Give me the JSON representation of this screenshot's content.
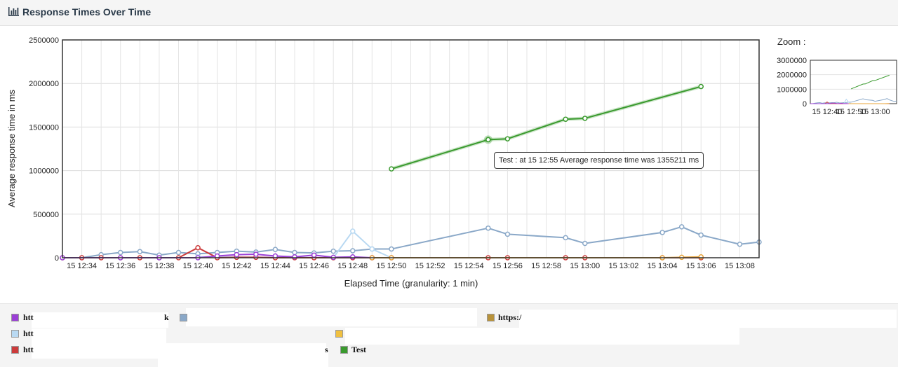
{
  "panel": {
    "title": "Response Times Over Time",
    "icon": "bar-chart-icon"
  },
  "chart_data": {
    "type": "line",
    "ylabel": "Average response time in ms",
    "xlabel": "Elapsed Time (granularity: 1 min)",
    "ylim": [
      0,
      2500000
    ],
    "yticks": [
      0,
      500000,
      1000000,
      1500000,
      2000000,
      2500000
    ],
    "xlim": [
      "12:33",
      "13:09"
    ],
    "xtick_labels": [
      "15 12:34",
      "15 12:36",
      "15 12:38",
      "15 12:40",
      "15 12:42",
      "15 12:44",
      "15 12:46",
      "15 12:48",
      "15 12:50",
      "15 12:52",
      "15 12:54",
      "15 12:56",
      "15 12:58",
      "15 13:00",
      "15 13:02",
      "15 13:04",
      "15 13:06",
      "15 13:08"
    ],
    "grid": true,
    "series": [
      {
        "name": "Test",
        "color": "#3a9a2e",
        "points": [
          [
            "12:50",
            1020000
          ],
          [
            "12:55",
            1355211
          ],
          [
            "12:56",
            1365000
          ],
          [
            "12:59",
            1590000
          ],
          [
            "13:00",
            1600000
          ],
          [
            "13:06",
            1965000
          ]
        ]
      },
      {
        "color": "#8aa8c8",
        "points": [
          [
            "12:33",
            0
          ],
          [
            "12:34",
            0
          ],
          [
            "12:35",
            35000
          ],
          [
            "12:36",
            60000
          ],
          [
            "12:37",
            70000
          ],
          [
            "12:38",
            30000
          ],
          [
            "12:39",
            60000
          ],
          [
            "12:40",
            45000
          ],
          [
            "12:41",
            60000
          ],
          [
            "12:42",
            75000
          ],
          [
            "12:43",
            65000
          ],
          [
            "12:44",
            95000
          ],
          [
            "12:45",
            60000
          ],
          [
            "12:46",
            55000
          ],
          [
            "12:47",
            75000
          ],
          [
            "12:48",
            80000
          ],
          [
            "12:49",
            100000
          ],
          [
            "12:50",
            100000
          ],
          [
            "12:55",
            340000
          ],
          [
            "12:56",
            270000
          ],
          [
            "12:59",
            230000
          ],
          [
            "13:00",
            165000
          ],
          [
            "13:04",
            290000
          ],
          [
            "13:05",
            355000
          ],
          [
            "13:06",
            260000
          ],
          [
            "13:08",
            155000
          ],
          [
            "13:09",
            180000
          ]
        ]
      },
      {
        "color": "#b9d9f2",
        "points": [
          [
            "12:40",
            10000
          ],
          [
            "12:47",
            0
          ],
          [
            "12:48",
            305000
          ],
          [
            "12:49",
            100000
          ],
          [
            "12:50",
            0
          ]
        ]
      },
      {
        "color": "#cc3b3b",
        "points": [
          [
            "12:33",
            0
          ],
          [
            "12:34",
            0
          ],
          [
            "12:35",
            0
          ],
          [
            "12:36",
            0
          ],
          [
            "12:37",
            0
          ],
          [
            "12:38",
            0
          ],
          [
            "12:39",
            0
          ],
          [
            "12:40",
            115000
          ],
          [
            "12:41",
            0
          ],
          [
            "12:42",
            5000
          ],
          [
            "12:43",
            5000
          ],
          [
            "12:44",
            0
          ],
          [
            "12:45",
            0
          ],
          [
            "12:46",
            0
          ],
          [
            "12:47",
            0
          ],
          [
            "12:48",
            0
          ],
          [
            "12:49",
            0
          ],
          [
            "12:50",
            0
          ],
          [
            "12:55",
            0
          ],
          [
            "12:56",
            0
          ],
          [
            "12:59",
            0
          ],
          [
            "13:00",
            0
          ],
          [
            "13:04",
            0
          ],
          [
            "13:06",
            0
          ]
        ]
      },
      {
        "color": "#9b3fd6",
        "points": [
          [
            "12:33",
            0
          ],
          [
            "12:36",
            0
          ],
          [
            "12:38",
            0
          ],
          [
            "12:40",
            0
          ],
          [
            "12:41",
            20000
          ],
          [
            "12:42",
            35000
          ],
          [
            "12:43",
            40000
          ],
          [
            "12:44",
            20000
          ],
          [
            "12:45",
            10000
          ],
          [
            "12:46",
            30000
          ],
          [
            "12:47",
            5000
          ],
          [
            "12:48",
            10000
          ],
          [
            "12:49",
            0
          ]
        ]
      },
      {
        "color": "#e8a43a",
        "points": [
          [
            "12:49",
            0
          ],
          [
            "12:50",
            0
          ],
          [
            "13:04",
            0
          ],
          [
            "13:05",
            5000
          ],
          [
            "13:06",
            10000
          ]
        ]
      }
    ],
    "tooltip": "Test : at 15 12:55 Average response time was 1355211 ms"
  },
  "zoom": {
    "title": "Zoom :",
    "yticks": [
      "3000000",
      "2000000",
      "1000000",
      "0"
    ],
    "xtick_labels": [
      "15 12:40",
      "15 12:50",
      "15 13:00"
    ]
  },
  "legend": {
    "items": [
      {
        "label": "htt",
        "color": "#9b3fd6"
      },
      {
        "label": "k",
        "color": "#8aa8c8"
      },
      {
        "label": "https:/",
        "color": "#b8923a"
      },
      {
        "label": "htt",
        "color": "#b9d9f2"
      },
      {
        "label": "",
        "color": "#f0c040"
      },
      {
        "label": "htt",
        "color": "#cc3b3b"
      },
      {
        "label": "s",
        "color": ""
      },
      {
        "label": "Test",
        "color": "#3a9a2e"
      }
    ]
  }
}
